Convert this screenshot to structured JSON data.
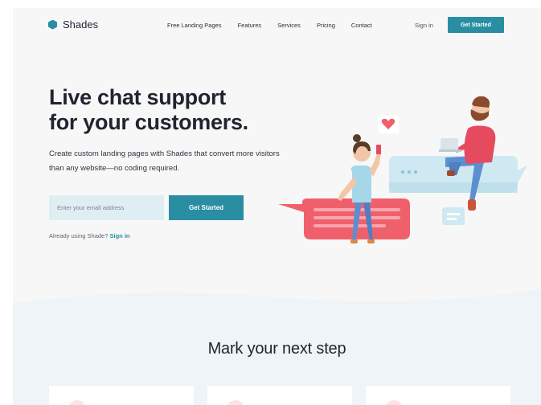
{
  "brand": {
    "name": "Shades",
    "accent": "#2a8ea3"
  },
  "nav": {
    "links": [
      "Free Landing Pages",
      "Features",
      "Services",
      "Pricing",
      "Contact"
    ],
    "sign_in": "Sign in",
    "cta": "Get Started"
  },
  "hero": {
    "title_line1": "Live chat support",
    "title_line2": "for your customers.",
    "subtitle": "Create custom landing pages with Shades that convert more visitors than any website—no coding required.",
    "email_placeholder": "Enter your email address",
    "cta": "Get Started",
    "already_text": "Already using Shade?",
    "already_link": "Sign in"
  },
  "section": {
    "title": "Mark your next step"
  },
  "colors": {
    "chat_pink": "#f0606c",
    "chat_blue": "#cfe9f2",
    "shirt_blue": "#a6d7e8",
    "shirt_pink": "#e64a5f"
  }
}
